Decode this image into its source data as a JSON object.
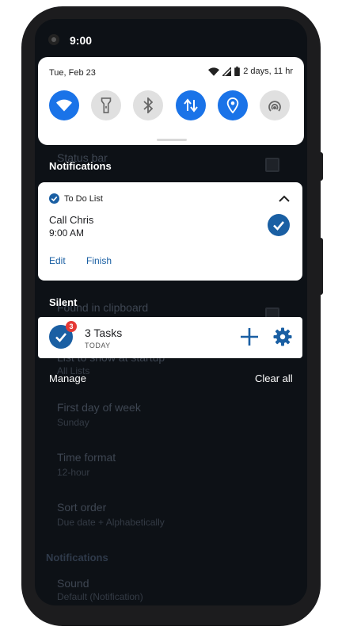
{
  "status_bar": {
    "time": "9:00"
  },
  "quick_settings": {
    "date": "Tue, Feb 23",
    "battery_text": "2 days, 11 hr",
    "tiles": [
      {
        "icon": "wifi-icon",
        "state": "on"
      },
      {
        "icon": "flashlight-icon",
        "state": "off"
      },
      {
        "icon": "bluetooth-icon",
        "state": "off"
      },
      {
        "icon": "mobile-data-icon",
        "state": "on"
      },
      {
        "icon": "location-icon",
        "state": "on"
      },
      {
        "icon": "hotspot-icon",
        "state": "off"
      }
    ]
  },
  "notifications": {
    "heading": "Notifications",
    "todo": {
      "app_name": "To Do List",
      "title": "Call Chris",
      "time": "9:00 AM",
      "actions": [
        "Edit",
        "Finish"
      ]
    },
    "silent_heading": "Silent",
    "tasks": {
      "badge": "3",
      "title": "3 Tasks",
      "subtitle": "TODAY"
    },
    "manage_label": "Manage",
    "clear_all_label": "Clear all"
  },
  "background_settings": {
    "items": [
      {
        "title": "Status bar",
        "sub": ""
      },
      {
        "title": "Found in clipboard",
        "sub": ""
      },
      {
        "title": "List to show at startup",
        "sub": "All Lists"
      },
      {
        "title": "First day of week",
        "sub": "Sunday"
      },
      {
        "title": "Time format",
        "sub": "12-hour"
      },
      {
        "title": "Sort order",
        "sub": "Due date + Alphabetically"
      },
      {
        "title": "Sound",
        "sub": "Default (Notification)"
      }
    ],
    "section": "Notifications"
  },
  "colors": {
    "accent": "#1a73e8",
    "app_blue": "#1a5fa3",
    "badge_red": "#e53935",
    "dim_bg": "#0d1116"
  }
}
